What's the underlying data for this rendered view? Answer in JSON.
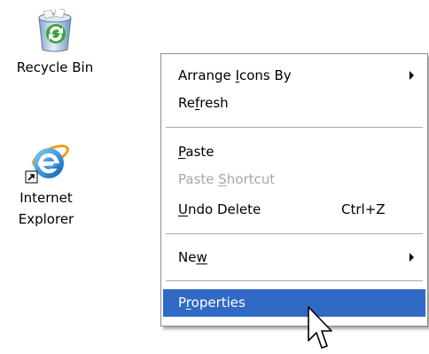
{
  "desktop": {
    "icons": [
      {
        "icon": "recycle-bin-icon",
        "label": "Recycle Bin"
      },
      {
        "icon": "internet-explorer-icon",
        "label_line1": "Internet",
        "label_line2": "Explorer"
      }
    ]
  },
  "context_menu": {
    "items": [
      {
        "pre": "Arrange ",
        "ul": "I",
        "post": "cons By",
        "submenu": true
      },
      {
        "pre": "Re",
        "ul": "f",
        "post": "resh"
      },
      {
        "pre": "",
        "ul": "P",
        "post": "aste"
      },
      {
        "pre": "Paste ",
        "ul": "S",
        "post": "hortcut",
        "disabled": true
      },
      {
        "pre": "",
        "ul": "U",
        "post": "ndo Delete",
        "accelerator": "Ctrl+Z"
      },
      {
        "pre": "Ne",
        "ul": "w",
        "post": "",
        "submenu": true
      },
      {
        "pre": "P",
        "ul": "r",
        "post": "operties",
        "selected": true
      }
    ]
  },
  "colors": {
    "selection": "#316ac5",
    "disabled_text": "#a7a7a7",
    "separator": "#a9a9a9"
  }
}
